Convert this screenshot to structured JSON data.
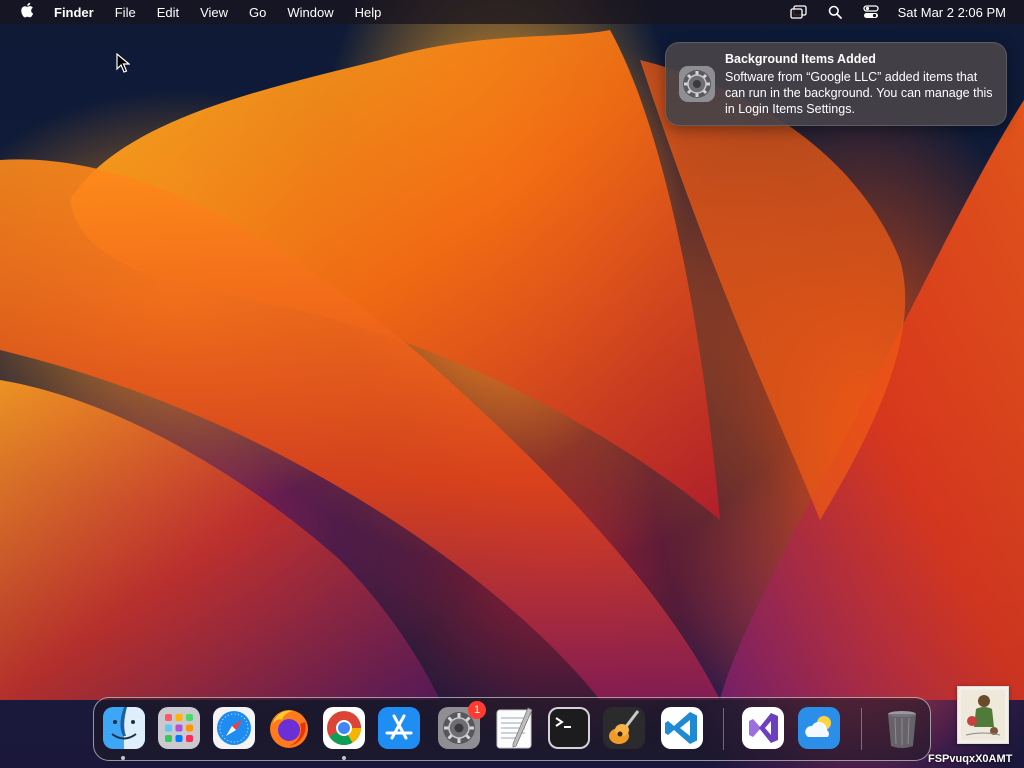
{
  "menubar": {
    "app_name": "Finder",
    "items": [
      "File",
      "Edit",
      "View",
      "Go",
      "Window",
      "Help"
    ],
    "clock": "Sat Mar 2  2:06 PM"
  },
  "notification": {
    "title": "Background Items Added",
    "body": "Software from “Google LLC” added items that can run in the background. You can manage this in Login Items Settings."
  },
  "dock": {
    "items": [
      {
        "name": "finder-icon",
        "running": true
      },
      {
        "name": "launchpad-icon",
        "running": false
      },
      {
        "name": "safari-icon",
        "running": false
      },
      {
        "name": "firefox-icon",
        "running": false
      },
      {
        "name": "chrome-icon",
        "running": true
      },
      {
        "name": "app-store-icon",
        "running": false
      },
      {
        "name": "system-settings-icon",
        "running": false,
        "badge": "1"
      },
      {
        "name": "textedit-icon",
        "running": false
      },
      {
        "name": "terminal-icon",
        "running": false
      },
      {
        "name": "garageband-icon",
        "running": false
      },
      {
        "name": "vscode-icon",
        "running": false
      },
      {
        "name": "visual-studio-icon",
        "running": false
      },
      {
        "name": "weather-icon",
        "running": false
      },
      {
        "name": "trash-icon",
        "running": false
      }
    ]
  },
  "watermark": "FSPvuqxX0AMT",
  "colors": {
    "menubar_bg": "#19141e",
    "notification_bg": "#464248",
    "badge": "#ff3b30"
  }
}
